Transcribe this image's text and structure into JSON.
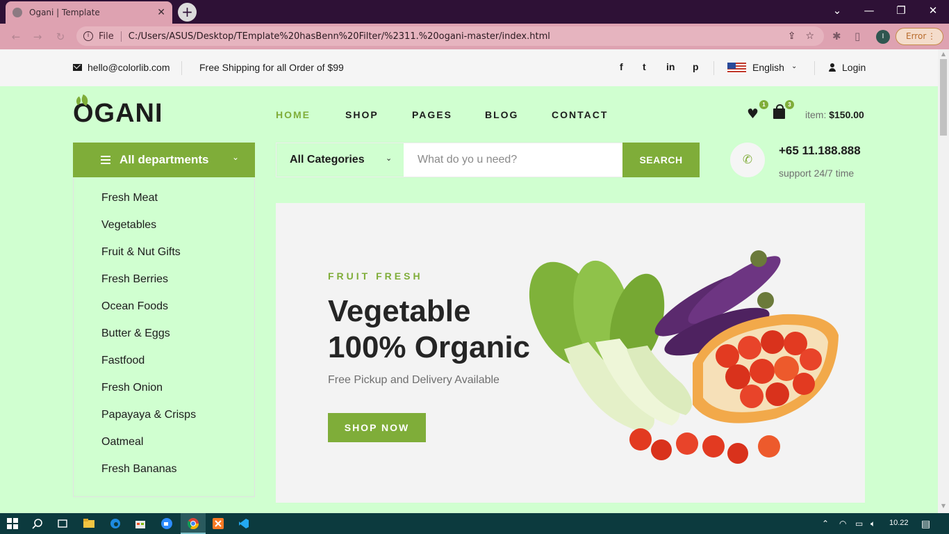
{
  "browser": {
    "tab_title": "Ogani | Template",
    "tab_close": "✕",
    "new_tab": "+",
    "scheme": "File",
    "url": "C:/Users/ASUS/Desktop/TEmplate%20hasBenn%20Filter/%2311.%20ogani-master/index.html",
    "profile_initial": "I",
    "error_label": "Error",
    "window_controls": {
      "dropdown": "⌄",
      "minimize": "—",
      "restore": "❐",
      "close": "✕"
    }
  },
  "topbar": {
    "email": "hello@colorlib.com",
    "shipping": "Free Shipping for all Order of $99",
    "social": {
      "facebook": "f",
      "twitter": "t",
      "linkedin": "in",
      "pinterest": "p"
    },
    "language": "English",
    "login": "Login"
  },
  "header": {
    "logo": "OGANI",
    "nav": [
      "HOME",
      "SHOP",
      "PAGES",
      "BLOG",
      "CONTACT"
    ],
    "active_nav": "HOME",
    "wishlist_count": "1",
    "cart_count": "3",
    "cart_label": "item:",
    "cart_total": "$150.00"
  },
  "departments": {
    "title": "All departments",
    "items": [
      "Fresh Meat",
      "Vegetables",
      "Fruit & Nut Gifts",
      "Fresh Berries",
      "Ocean Foods",
      "Butter & Eggs",
      "Fastfood",
      "Fresh Onion",
      "Papayaya & Crisps",
      "Oatmeal",
      "Fresh Bananas"
    ]
  },
  "search": {
    "category": "All Categories",
    "placeholder": "What do yo u need?",
    "button": "SEARCH"
  },
  "contact": {
    "phone": "+65 11.188.888",
    "support": "support 24/7 time"
  },
  "hero": {
    "eyebrow": "FRUIT FRESH",
    "headline_line1": "Vegetable",
    "headline_line2": "100% Organic",
    "subtitle": "Free Pickup and Delivery Available",
    "cta": "SHOP NOW"
  },
  "taskbar": {
    "clock": "10.22"
  },
  "colors": {
    "accent": "#7fad39",
    "page_bg": "#d0ffd0",
    "browser_frame": "#2e1136",
    "omnibox": "#dea2b1"
  },
  "icons": [
    "search-icon",
    "mail-icon",
    "facebook-icon",
    "twitter-icon",
    "linkedin-icon",
    "pinterest-icon",
    "user-icon",
    "heart-icon",
    "shopping-bag-icon",
    "phone-icon",
    "hamburger-icon",
    "chevron-down-icon"
  ]
}
